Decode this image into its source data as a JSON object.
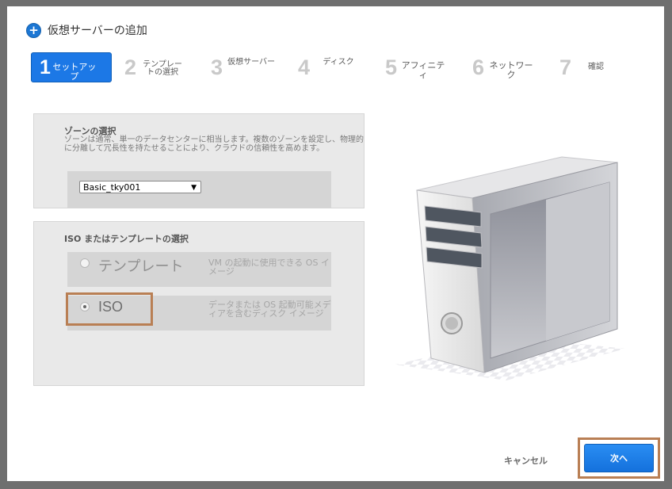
{
  "dialog": {
    "title": "仮想サーバーの追加"
  },
  "steps": [
    {
      "num": "1",
      "label": "セットアップ",
      "active": true
    },
    {
      "num": "2",
      "label": "テンプレートの選択"
    },
    {
      "num": "3",
      "label": "仮想サーバー"
    },
    {
      "num": "4",
      "label": "ディスク"
    },
    {
      "num": "5",
      "label": "アフィニティ"
    },
    {
      "num": "6",
      "label": "ネットワーク"
    },
    {
      "num": "7",
      "label": "確認"
    }
  ],
  "zone": {
    "title": "ゾーンの選択",
    "description": "ゾーンは通常、単一のデータセンターに相当します。複数のゾーンを設定し、物理的に分離して冗長性を持たせることにより、クラウドの信頼性を高めます。",
    "selected": "Basic_tky001"
  },
  "iso_section": {
    "title": "ISO またはテンプレートの選択",
    "template_label": "テンプレート",
    "template_desc": "VM の起動に使用できる OS イメージ",
    "iso_label": "ISO",
    "iso_desc": "データまたは OS 起動可能メディアを含むディスク イメージ",
    "selected": "ISO"
  },
  "footer": {
    "cancel_label": "キャンセル",
    "next_label": "次へ"
  },
  "icons": {
    "title_icon": "plus-circle-icon",
    "dropdown_icon": "triangle-down-icon"
  },
  "colors": {
    "accent": "#1c78e6",
    "highlight": "#b97f54"
  }
}
